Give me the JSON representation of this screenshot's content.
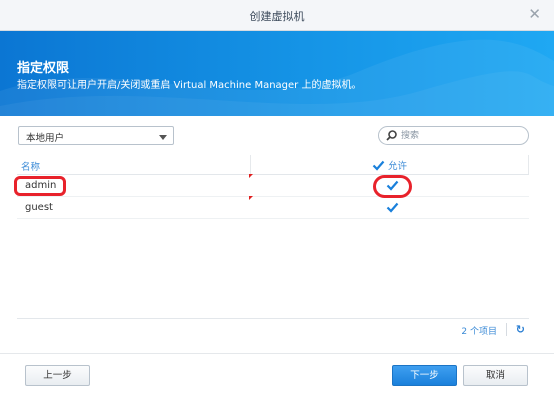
{
  "window": {
    "title": "创建虚拟机",
    "close_icon": "close-icon"
  },
  "banner": {
    "heading": "指定权限",
    "description": "指定权限可让用户开启/关闭或重启 Virtual Machine Manager 上的虚拟机。"
  },
  "toolbar": {
    "user_type_selected": "本地用户",
    "search_placeholder": "搜索"
  },
  "table": {
    "columns": [
      "名称",
      "允许"
    ],
    "header_checkbox_checked": true,
    "rows": [
      {
        "name": "admin",
        "allowed": true
      },
      {
        "name": "guest",
        "allowed": true
      }
    ]
  },
  "footer": {
    "item_count": "2 个项目",
    "refresh_icon": "refresh-icon"
  },
  "buttons": {
    "prev": "上一步",
    "next": "下一步",
    "cancel": "取消"
  },
  "colors": {
    "accent": "#1a80db",
    "highlight": "#e8222b",
    "check": "#1a80db"
  }
}
